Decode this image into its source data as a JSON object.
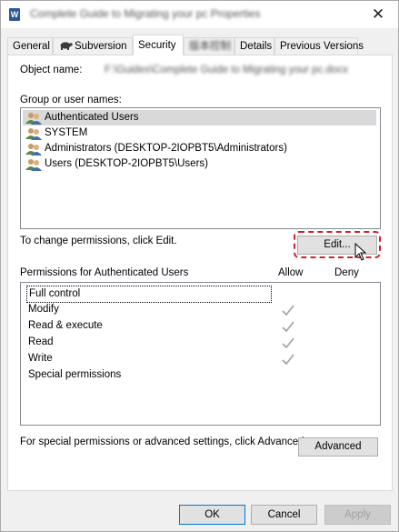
{
  "window": {
    "title": "Complete Guide to Migrating your pc Properties",
    "app_icon_letter": "W",
    "close_glyph": "✕"
  },
  "tabs": [
    {
      "label": "General"
    },
    {
      "label": "Subversion"
    },
    {
      "label": "Security"
    },
    {
      "label": "版本控制"
    },
    {
      "label": "Details"
    },
    {
      "label": "Previous Versions"
    }
  ],
  "active_tab": "Security",
  "object_name": {
    "label": "Object name:",
    "value": "F:\\Guides\\Complete Guide to Migrating your pc.docx"
  },
  "groups": {
    "label": "Group or user names:",
    "items": [
      {
        "name": "Authenticated Users",
        "icon": "users-icon",
        "selected": true
      },
      {
        "name": "SYSTEM",
        "icon": "users-icon",
        "selected": false
      },
      {
        "name": "Administrators (DESKTOP-2IOPBT5\\Administrators)",
        "icon": "users-icon",
        "selected": false
      },
      {
        "name": "Users (DESKTOP-2IOPBT5\\Users)",
        "icon": "users-icon",
        "selected": false
      }
    ]
  },
  "change_hint": "To change permissions, click Edit.",
  "edit_button": "Edit...",
  "permissions": {
    "label": "Permissions for Authenticated Users",
    "allow_header": "Allow",
    "deny_header": "Deny",
    "rows": [
      {
        "name": "Full control",
        "allow": false,
        "deny": false
      },
      {
        "name": "Modify",
        "allow": true,
        "deny": false
      },
      {
        "name": "Read & execute",
        "allow": true,
        "deny": false
      },
      {
        "name": "Read",
        "allow": true,
        "deny": false
      },
      {
        "name": "Write",
        "allow": true,
        "deny": false
      },
      {
        "name": "Special permissions",
        "allow": false,
        "deny": false
      }
    ]
  },
  "advanced_hint": "For special permissions or advanced settings, click Advanced.",
  "advanced_button": "Advanced",
  "footer": {
    "ok": "OK",
    "cancel": "Cancel",
    "apply": "Apply"
  },
  "colors": {
    "highlight_dashed": "#d2202a",
    "selection": "#d9d9d9",
    "check": "#a0a0a0"
  }
}
